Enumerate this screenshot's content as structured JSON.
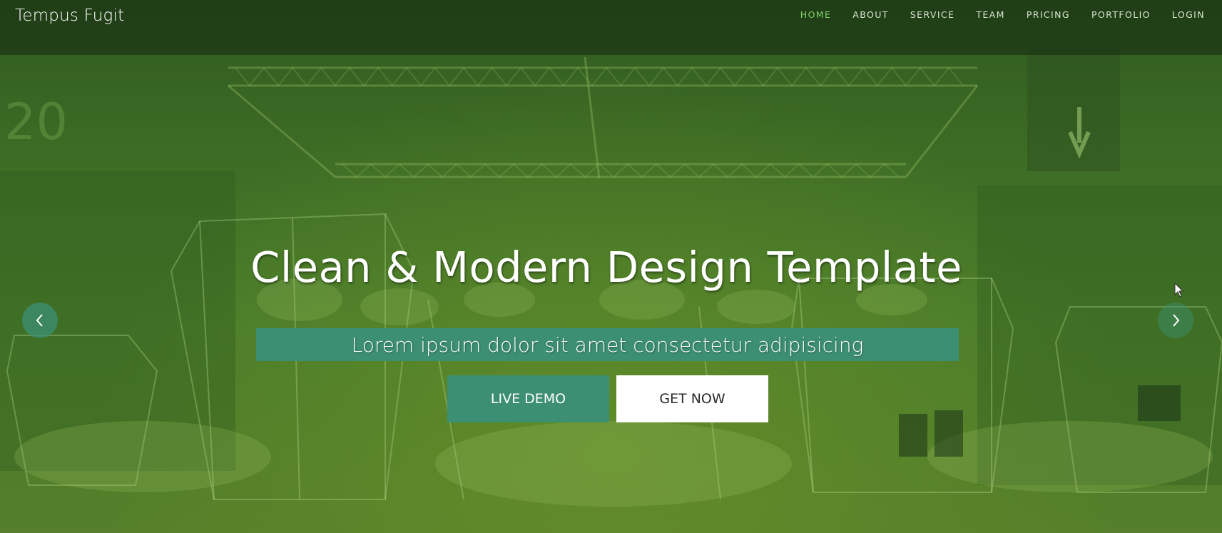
{
  "brand": {
    "name": "Tempus Fugit"
  },
  "nav": {
    "items": [
      {
        "label": "HOME",
        "active": true
      },
      {
        "label": "ABOUT",
        "active": false
      },
      {
        "label": "SERVICE",
        "active": false
      },
      {
        "label": "TEAM",
        "active": false
      },
      {
        "label": "PRICING",
        "active": false
      },
      {
        "label": "PORTFOLIO",
        "active": false
      },
      {
        "label": "LOGIN",
        "active": false
      }
    ]
  },
  "hero": {
    "headline": "Clean & Modern Design Template",
    "subtitle": "Lorem ipsum dolor sit amet consectetur adipisicing",
    "primary_button": "LIVE DEMO",
    "secondary_button": "GET NOW"
  },
  "carousel": {
    "prev_icon": "chevron-left-icon",
    "next_icon": "chevron-right-icon"
  },
  "colors": {
    "accent": "#3c8f73",
    "nav_active": "#7fd36a",
    "overlay_green": "#4a7c2a"
  }
}
